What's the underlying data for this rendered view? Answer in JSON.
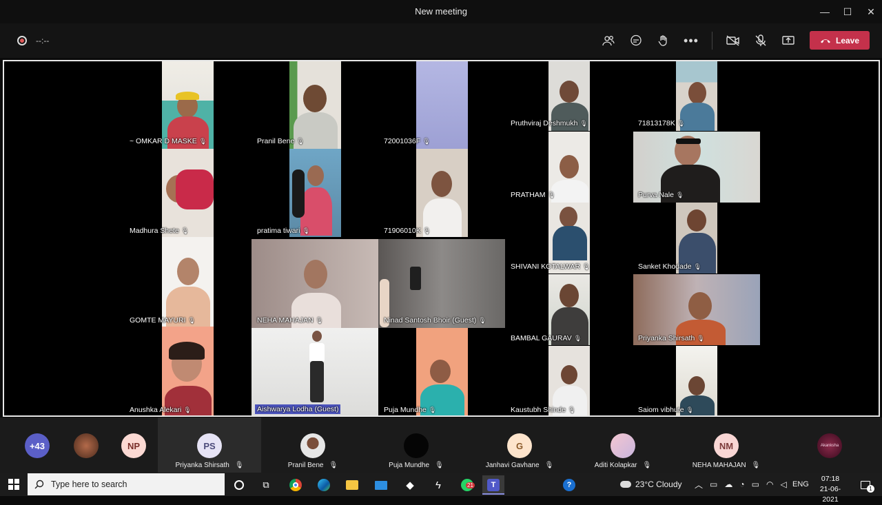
{
  "window": {
    "title": "New meeting",
    "minimize": "—",
    "maximize": "☐",
    "close": "✕"
  },
  "toolbar": {
    "timer": "--:--",
    "leave_label": "Leave"
  },
  "tiles": [
    {
      "name": "~ OMKAR D MASKE"
    },
    {
      "name": "Madhura Shete"
    },
    {
      "name": "GOMTE MAYURI"
    },
    {
      "name": "Anushka Alekari"
    },
    {
      "name": "Pranil Bene"
    },
    {
      "name": "pratima tiwari"
    },
    {
      "name": "NEHA MAHAJAN"
    },
    {
      "name": "Aishwarya Lodha (Guest)"
    },
    {
      "name": "72001036F"
    },
    {
      "name": "71906010K"
    },
    {
      "name": "Ninad Santosh Bhoir (Guest)"
    },
    {
      "name": "Puja Mundhe"
    },
    {
      "name": "Pruthviraj Deshmukh"
    },
    {
      "name": "PRATHAM"
    },
    {
      "name": "SHIVANI KOTALWAR"
    },
    {
      "name": "BAMBAL GAURAV"
    },
    {
      "name": "Kaustubh Shinde"
    },
    {
      "name": "71813178K"
    },
    {
      "name": "Purva Nale"
    },
    {
      "name": "Sanket Khodade"
    },
    {
      "name": "Priyanka Shirsath"
    },
    {
      "name": "Saiom vibhute"
    }
  ],
  "strip": {
    "overflow": "+43",
    "np_initials": "NP",
    "people": [
      {
        "initials": "PS",
        "name": "Priyanka Shirsath"
      },
      {
        "initials": "",
        "name": "Pranil Bene"
      },
      {
        "initials": "",
        "name": "Puja Mundhe"
      },
      {
        "initials": "G",
        "name": "Janhavi Gavhane"
      },
      {
        "initials": "",
        "name": "Aditi Kolapkar"
      },
      {
        "initials": "NM",
        "name": "NEHA MAHAJAN"
      }
    ],
    "last_avatar_label": "Akanksha"
  },
  "taskbar": {
    "search_placeholder": "Type here to search",
    "whatsapp_badge": "21",
    "weather": "23°C  Cloudy",
    "lang": "ENG",
    "time": "07:18",
    "date": "21-06-2021",
    "notif_count": "1"
  }
}
